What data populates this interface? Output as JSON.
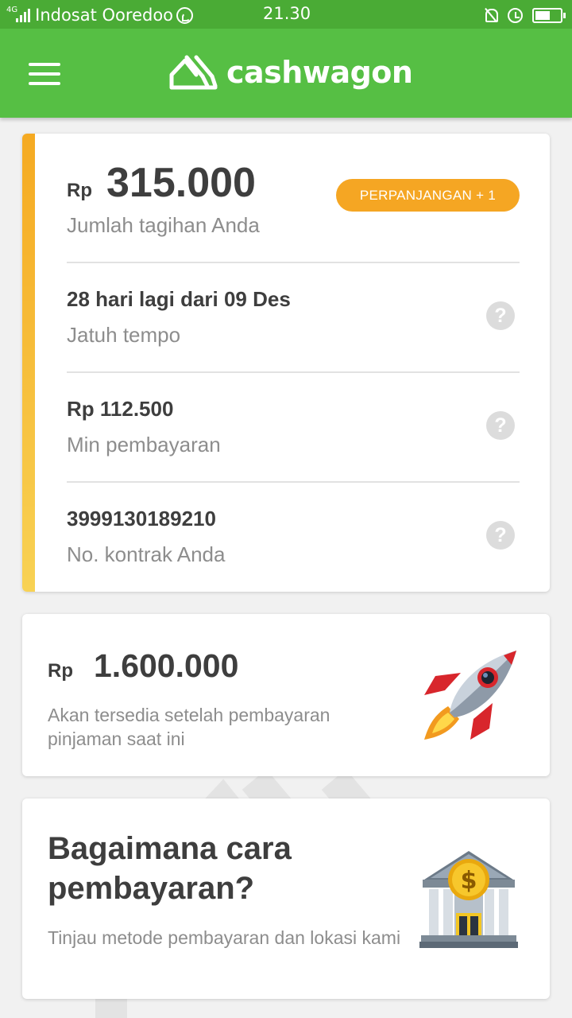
{
  "status_bar": {
    "network": "4G",
    "carrier": "Indosat Ooredoo",
    "time": "21.30",
    "icons": [
      "signal-icon",
      "whatsapp-icon",
      "bell-off-icon",
      "alarm-icon",
      "battery-icon"
    ],
    "battery_level": 0.5
  },
  "app_bar": {
    "brand": "cashwagon",
    "menu_icon": "menu-icon",
    "color": "#56bf44"
  },
  "bill": {
    "currency": "Rp",
    "amount": "315.000",
    "amount_label": "Jumlah tagihan Anda",
    "extend_button": "PERPANJANGAN + 1",
    "accent_color": "#f5a623",
    "rows": [
      {
        "value": "28 hari lagi dari 09 Des",
        "label": "Jatuh tempo",
        "help": "?"
      },
      {
        "value": "Rp  112.500",
        "label": "Min pembayaran",
        "help": "?"
      },
      {
        "value": "3999130189210",
        "label": "No. kontrak Anda",
        "help": "?"
      }
    ]
  },
  "offer": {
    "currency": "Rp",
    "amount": "1.600.000",
    "note": "Akan tersedia setelah pembayaran pinjaman saat ini",
    "icon": "rocket-icon"
  },
  "howto": {
    "title": "Bagaimana cara pembayaran?",
    "note": "Tinjau metode pembayaran dan lokasi kami",
    "icon": "bank-icon",
    "icon_symbol": "$"
  }
}
